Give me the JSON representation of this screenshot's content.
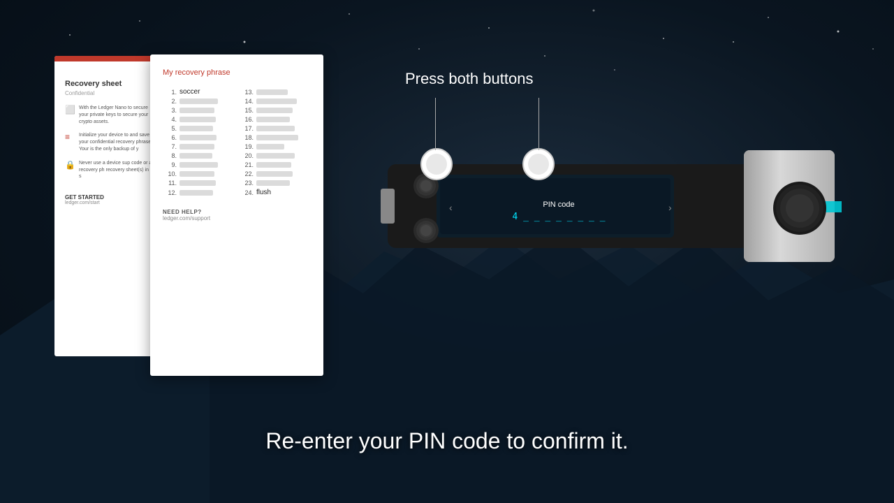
{
  "background": {
    "color": "#0a1520"
  },
  "header": {
    "press_label": "Press both buttons"
  },
  "recovery_sheet": {
    "title": "Recovery sheet",
    "subtitle": "Confidential",
    "section1_text": "With the Ledger Nano to secure your private keys to secure your crypto assets.",
    "section2_text": "Initialize your device to and save your confidential recovery phrase. Your is the only backup of y",
    "section3_text": "Never use a device sup code or a recovery ph recovery sheet(s) in a s",
    "get_started": "GET STARTED",
    "link": "ledger.com/start"
  },
  "recovery_paper": {
    "title": "My recovery phrase",
    "words": [
      {
        "num": "1.",
        "word": "soccer",
        "blur": false
      },
      {
        "num": "2.",
        "word": "",
        "blur": true,
        "width": 55
      },
      {
        "num": "3.",
        "word": "",
        "blur": true,
        "width": 50
      },
      {
        "num": "4.",
        "word": "",
        "blur": true,
        "width": 52
      },
      {
        "num": "5.",
        "word": "",
        "blur": true,
        "width": 48
      },
      {
        "num": "6.",
        "word": "",
        "blur": true,
        "width": 53
      },
      {
        "num": "7.",
        "word": "",
        "blur": true,
        "width": 50
      },
      {
        "num": "8.",
        "word": "",
        "blur": true,
        "width": 47
      },
      {
        "num": "9.",
        "word": "",
        "blur": true,
        "width": 55
      },
      {
        "num": "10.",
        "word": "",
        "blur": true,
        "width": 50
      },
      {
        "num": "11.",
        "word": "",
        "blur": true,
        "width": 52
      },
      {
        "num": "12.",
        "word": "",
        "blur": true,
        "width": 48
      },
      {
        "num": "13.",
        "word": "",
        "blur": true,
        "width": 45
      },
      {
        "num": "14.",
        "word": "",
        "blur": true,
        "width": 58
      },
      {
        "num": "15.",
        "word": "",
        "blur": true,
        "width": 52
      },
      {
        "num": "16.",
        "word": "",
        "blur": true,
        "width": 48
      },
      {
        "num": "17.",
        "word": "",
        "blur": true,
        "width": 55
      },
      {
        "num": "18.",
        "word": "",
        "blur": true,
        "width": 60
      },
      {
        "num": "19.",
        "word": "",
        "blur": true,
        "width": 40
      },
      {
        "num": "20.",
        "word": "",
        "blur": true,
        "width": 55
      },
      {
        "num": "21.",
        "word": "",
        "blur": true,
        "width": 50
      },
      {
        "num": "22.",
        "word": "",
        "blur": true,
        "width": 52
      },
      {
        "num": "23.",
        "word": "",
        "blur": true,
        "width": 48
      },
      {
        "num": "24.",
        "word": "flush",
        "blur": false
      }
    ],
    "need_help_label": "NEED HELP?",
    "need_help_link": "ledger.com/support"
  },
  "device": {
    "screen_label": "PIN code",
    "pin_value": "4 _ _ _ _ _ _ _ _"
  },
  "caption": {
    "text": "Re-enter your PIN code to confirm it."
  }
}
